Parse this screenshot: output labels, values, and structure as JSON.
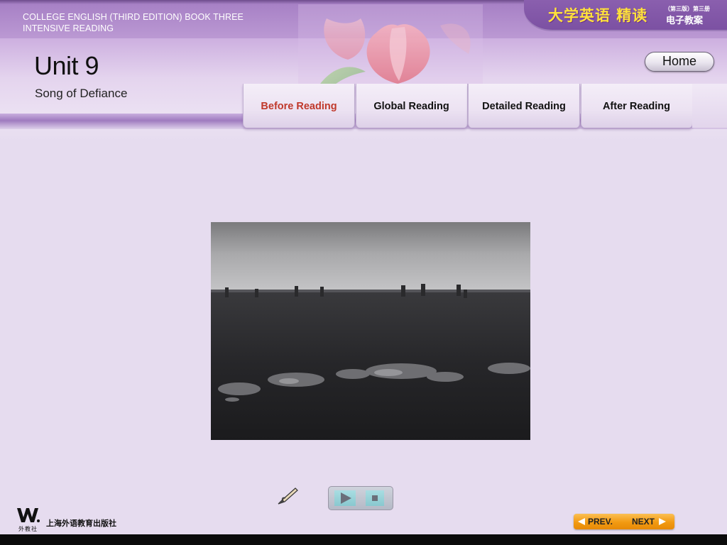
{
  "header": {
    "book_title": "COLLEGE ENGLISH (THIRD EDITION) BOOK THREE INTENSIVE READING",
    "brand_main": "大学英语 精读",
    "brand_sub_top": "（第三版）第三册",
    "brand_sub_bottom": "电子教案",
    "unit_title": "Unit 9",
    "unit_subtitle": "Song of Defiance",
    "home_label": "Home"
  },
  "tabs": [
    {
      "label": "Before Reading",
      "active": true
    },
    {
      "label": "Global Reading",
      "active": false
    },
    {
      "label": "Detailed Reading",
      "active": false
    },
    {
      "label": "After Reading",
      "active": false
    }
  ],
  "media": {
    "icons": [
      "pen-icon",
      "play-icon",
      "stop-icon"
    ]
  },
  "footer": {
    "logo_text": "外教社",
    "publisher": "上海外语教育出版社",
    "prev_label": "PREV.",
    "next_label": "NEXT"
  },
  "colors": {
    "active_tab": "#c0392b",
    "brand_yellow": "#ffe23b",
    "nav_orange": "#f29a12"
  }
}
